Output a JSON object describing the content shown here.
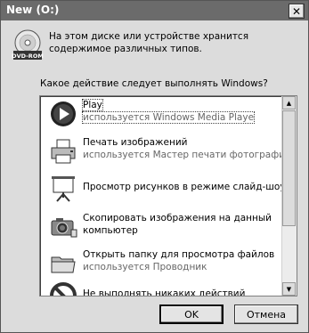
{
  "window": {
    "title": "New (O:)",
    "close_symbol": "✕"
  },
  "dvd_icon_label": "DVD-ROM",
  "message": "На этом диске или устройстве хранится содержимое различных типов.",
  "question": "Какое действие следует выполнять Windows?",
  "actions": [
    {
      "title": "Play",
      "subtitle": "используется Windows Media Playe",
      "icon": "media-player-icon"
    },
    {
      "title": "Печать изображений",
      "subtitle": "используется Мастер печати фотографий",
      "icon": "printer-icon"
    },
    {
      "title": "Просмотр рисунков в режиме слайд-шоу",
      "subtitle": "",
      "icon": "slideshow-icon"
    },
    {
      "title": "Скопировать изображения на данный компьютер",
      "subtitle": "",
      "icon": "camera-icon"
    },
    {
      "title": "Открыть папку для просмотра файлов",
      "subtitle": "используется Проводник",
      "icon": "folder-icon"
    },
    {
      "title": "Не выполнять никаких действий",
      "subtitle": "",
      "icon": "no-action-icon"
    }
  ],
  "buttons": {
    "ok": "OK",
    "cancel": "Отмена"
  }
}
